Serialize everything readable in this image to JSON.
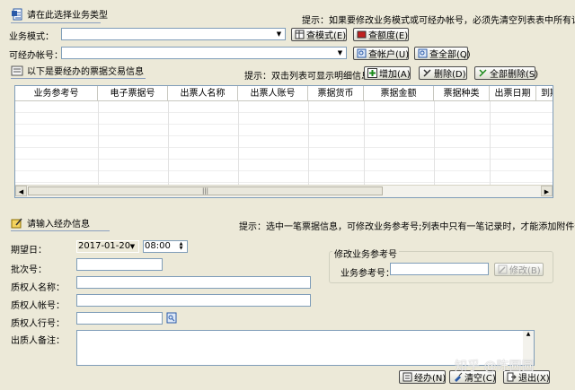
{
  "section1": {
    "title": "请在此选择业务类型",
    "hint": "提示：如果要修改业务模式或可经办帐号，必须先清空列表表中所有记录",
    "business_mode_label": "业务模式：",
    "business_mode_value": "",
    "account_label": "可经办帐号：",
    "account_value": "",
    "btn_check_mode": "查模式(E)",
    "btn_check_quota": "查额度(E)",
    "btn_check_account": "查帐户(U)",
    "btn_check_all": "查全部(Q)"
  },
  "section2": {
    "title": "以下是要经办的票据交易信息",
    "hint": "提示：双击列表可显示明细信息",
    "btn_add": "增加(A)",
    "btn_delete": "删除(D)",
    "btn_delete_all": "全部删除(S)",
    "columns": [
      "业务参考号",
      "电子票据号",
      "出票人名称",
      "出票人账号",
      "票据货币",
      "票据金额",
      "票据种类",
      "出票日期",
      "到期"
    ]
  },
  "section3": {
    "title": "请输入经办信息",
    "hint": "提示：选中一笔票据信息，可修改业务参考号;列表中只有一笔记录时，才能添加附件信息",
    "expected_date_label": "期望日：",
    "expected_date_value": "2017-01-20",
    "expected_time_value": "08:00",
    "batch_label": "批次号：",
    "pledgee_name_label": "质权人名称：",
    "pledgee_account_label": "质权人帐号：",
    "pledgee_bank_label": "质权人行号：",
    "remark_label": "出质人备注：",
    "modify_group_title": "修改业务参考号",
    "ref_no_label": "业务参考号：",
    "btn_modify": "修改(B)",
    "btn_handle": "经办(N)",
    "btn_clear": "清空(C)",
    "btn_exit": "退出(X)"
  },
  "watermark": "知乎 @陈圆圆"
}
